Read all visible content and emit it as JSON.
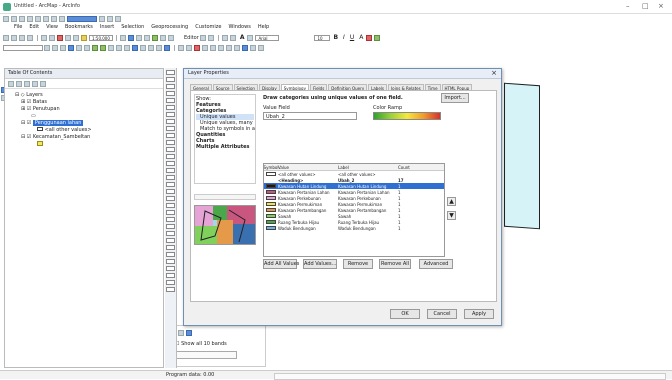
{
  "titlebar": {
    "title": "Untitled - ArcMap - ArcInfo"
  },
  "menu": [
    "File",
    "Edit",
    "View",
    "Bookmarks",
    "Insert",
    "Selection",
    "Geoprocessing",
    "Customize",
    "Windows",
    "Help"
  ],
  "toolbar": {
    "scale": "1:50,000",
    "editor": "Editor",
    "font": "Arial",
    "font_size": "10"
  },
  "toc": {
    "title": "Table Of Contents",
    "layers": "Layers",
    "items": [
      "Batas",
      "Penutupan",
      "Penggunaan lahan",
      "<all other values>",
      "Kecamatan_Sambeltan"
    ]
  },
  "dialog": {
    "title": "Layer Properties",
    "tabs": [
      "General",
      "Source",
      "Selection",
      "Display",
      "Symbology",
      "Fields",
      "Definition Query",
      "Labels",
      "Joins & Relates",
      "Time",
      "HTML Popup"
    ],
    "active_tab": "Symbology",
    "show_label": "Show:",
    "show_items": [
      {
        "label": "Features",
        "bold": true,
        "sub": false
      },
      {
        "label": "Categories",
        "bold": true,
        "sub": false
      },
      {
        "label": "Unique values",
        "bold": false,
        "sub": true
      },
      {
        "label": "Unique values, many",
        "bold": false,
        "sub": true
      },
      {
        "label": "Match to symbols in a",
        "bold": false,
        "sub": true
      },
      {
        "label": "Quantities",
        "bold": true,
        "sub": false
      },
      {
        "label": "Charts",
        "bold": true,
        "sub": false
      },
      {
        "label": "Multiple Attributes",
        "bold": true,
        "sub": false
      }
    ],
    "heading": "Draw categories using unique values of one field.",
    "import_label": "Import...",
    "value_field_label": "Value Field",
    "value_field": "Ubah_2",
    "color_ramp_label": "Color Ramp",
    "columns": {
      "symbol": "Symbol",
      "value": "Value",
      "label": "Label",
      "count": "Count"
    },
    "rows": [
      {
        "value": "<all other values>",
        "label": "<all other values>",
        "count": "",
        "color": "#ffffff"
      },
      {
        "value": "<Heading>",
        "label": "Ubah_2",
        "count": "17",
        "color": "",
        "bold": true
      },
      {
        "value": "Kawasan Hutan Lindung",
        "label": "Kawasan Hutan Lindung",
        "count": "1",
        "color": "#1a1a1a",
        "selected": true
      },
      {
        "value": "Kawasan Pertanian Lahan",
        "label": "Kawasan Pertanian Lahan",
        "count": "1",
        "color": "#c9567f"
      },
      {
        "value": "Kawasan Perkebunan",
        "label": "Kawasan Perkebunan",
        "count": "1",
        "color": "#e6a3d6"
      },
      {
        "value": "Kawasan Permukiman",
        "label": "Kawasan Permukiman",
        "count": "1",
        "color": "#f0e34a"
      },
      {
        "value": "Kawasan Pertambangan",
        "label": "Kawasan Pertambangan",
        "count": "1",
        "color": "#e59a4a"
      },
      {
        "value": "Sawah",
        "label": "Sawah",
        "count": "1",
        "color": "#7fd15c"
      },
      {
        "value": "Ruang Terbuka Hijau",
        "label": "Ruang Terbuka Hijau",
        "count": "1",
        "color": "#4aa84a"
      },
      {
        "value": "Waduk Bendungan",
        "label": "Waduk Bendungan",
        "count": "1",
        "color": "#6fb2e8"
      }
    ],
    "buttons": {
      "add_all": "Add All Values",
      "add_values": "Add Values...",
      "remove": "Remove",
      "remove_all": "Remove All",
      "advanced": "Advanced"
    },
    "footer": {
      "ok": "OK",
      "cancel": "Cancel",
      "apply": "Apply"
    }
  },
  "left_bottom": {
    "checkbox_label": "Show all 10 bands"
  },
  "status": {
    "left": "Program data: 0.00"
  }
}
